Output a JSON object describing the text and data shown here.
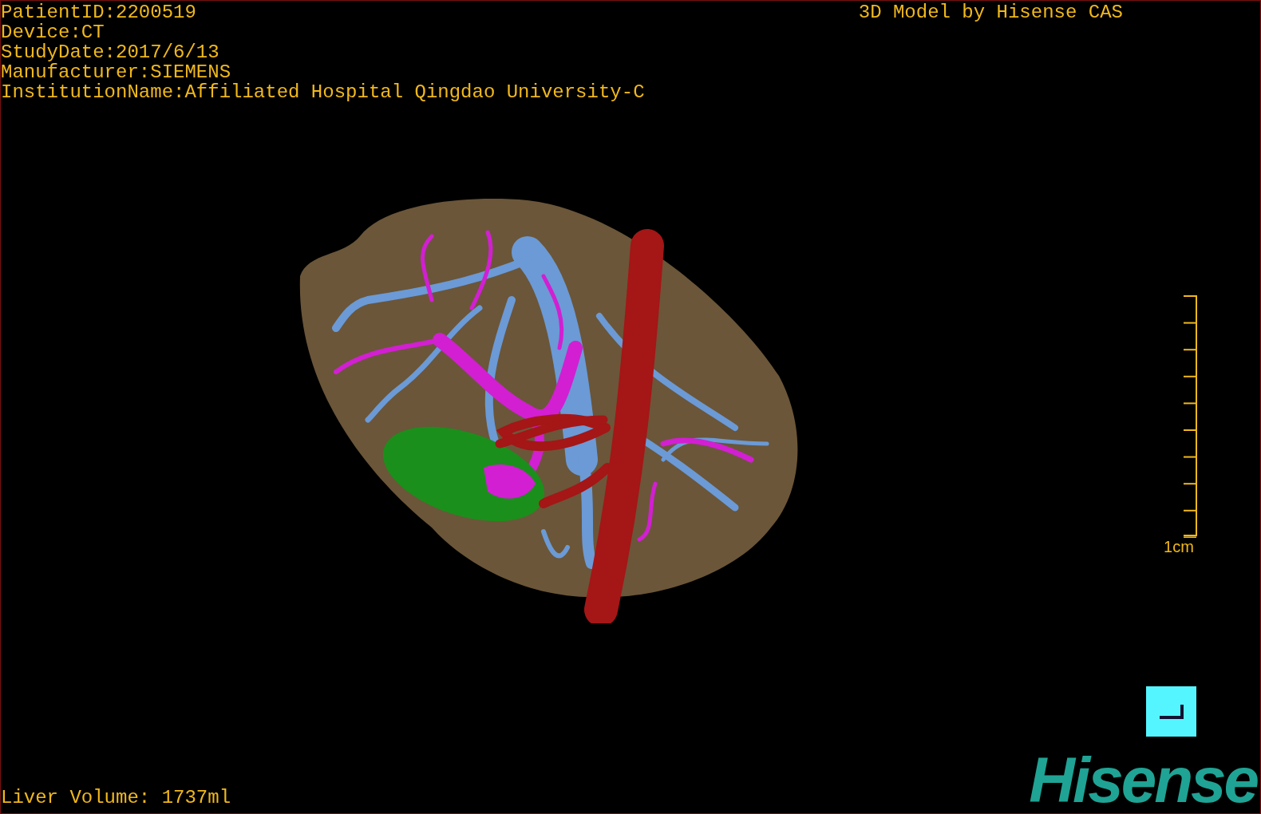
{
  "patient_info": [
    "PatientID:2200519",
    "Device:CT",
    "StudyDate:2017/6/13",
    "Manufacturer:SIEMENS",
    "InstitutionName:Affiliated Hospital Qingdao University-C"
  ],
  "title": "3D Model by Hisense CAS",
  "scale": {
    "label": "1cm"
  },
  "volume": "Liver Volume: 1737ml",
  "logo": "Hisense"
}
